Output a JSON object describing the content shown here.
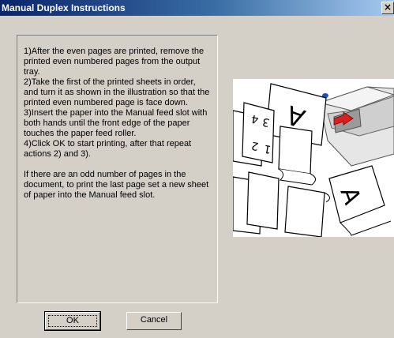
{
  "window": {
    "title": "Manual Duplex Instructions",
    "close_glyph": "×"
  },
  "instructions": {
    "step1": "1)After the even pages are printed, remove the printed even numbered pages from the output tray.",
    "step2": "2)Take the first of the printed sheets in order, and turn it as shown in the illustration so that the printed even numbered page is face down.",
    "step3": "3)Insert the paper into the Manual feed slot with both hands until the front edge of the paper touches the paper feed roller.",
    "step4": "4)Click OK to start printing, after that repeat actions 2) and 3).",
    "note": " If there are an odd number of pages in the document, to print the last page set a new sheet of paper into the Manual feed slot."
  },
  "illustration": {
    "icon": "printer-duplex-illustration",
    "arrow_color": "#d82020",
    "printer_light_color": "#2050c0",
    "page_letter": "A",
    "stack_numbers": [
      "4",
      "3",
      "2",
      "1"
    ]
  },
  "buttons": {
    "ok_label": "OK",
    "cancel_label": "Cancel"
  }
}
